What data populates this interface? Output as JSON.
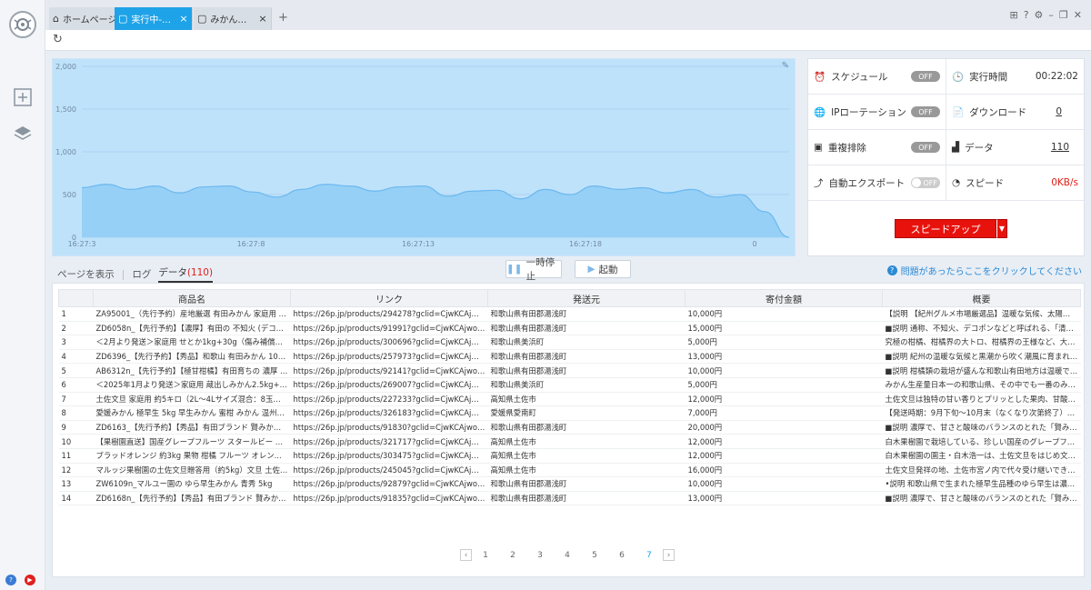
{
  "tabs": [
    {
      "label": "ホームページ"
    },
    {
      "label": "実行中-みかん..."
    },
    {
      "label": "みかん・..."
    }
  ],
  "chart_data": {
    "type": "area",
    "x_ticks": [
      "16:27:3",
      "16:27:8",
      "16:27:13",
      "16:27:18",
      "0"
    ],
    "y_ticks": [
      "2,000",
      "1,500",
      "1,000",
      "500",
      "0"
    ],
    "ylim": [
      0,
      2000
    ],
    "grid": true,
    "series": [
      {
        "values": [
          580,
          620,
          560,
          600,
          520,
          590,
          600,
          530,
          470,
          560,
          620,
          600,
          540,
          590,
          600,
          480,
          540,
          550,
          450,
          560,
          500,
          600,
          560,
          580,
          520,
          560,
          470,
          500,
          300,
          0
        ]
      }
    ],
    "colors": {
      "fill": "#8fcdf5",
      "line": "#6bb8ef"
    }
  },
  "stats": {
    "schedule": {
      "label": "スケジュール",
      "state": "OFF"
    },
    "runtime": {
      "label": "実行時間",
      "value": "00:22:02"
    },
    "ip": {
      "label": "IPローテーション",
      "state": "OFF"
    },
    "download": {
      "label": "ダウンロード",
      "value": "0"
    },
    "dedupe": {
      "label": "重複排除",
      "state": "OFF"
    },
    "data": {
      "label": "データ",
      "value": "110"
    },
    "export": {
      "label": "自動エクスポート",
      "state": "OFF"
    },
    "speed": {
      "label": "スピード",
      "value": "0KB/s"
    },
    "speed_button": "スピードアップ"
  },
  "panel": {
    "tab_page": "ページを表示",
    "tab_log": "ログ",
    "tab_data": "データ",
    "data_count": "(110)",
    "pause": "一時停止",
    "start": "起動",
    "help": "問題があったらここをクリックしてください"
  },
  "table": {
    "columns": [
      "",
      "商品名",
      "リンク",
      "発送元",
      "寄付金額",
      "概要"
    ],
    "rows": [
      [
        "1",
        "ZA95001_（先行予約）産地厳選 有田みかん 家庭用 約5kg(2...",
        "https://26p.jp/products/294278?gclid=CjwKCAjwooq3BhB3Eiw...",
        "和歌山県有田郡湯浅町",
        "10,000円",
        "【説明 【紀州グルメ市場厳選品】温暖な気候、太陽が降..."
      ],
      [
        "2",
        "ZD6058n_【先行予約】【濃厚】有田の 不知火 (デコポン) 約...",
        "https://26p.jp/products/91991?gclid=CjwKCAjwooq3BhB3Eiw...",
        "和歌山県有田郡湯浅町",
        "15,000円",
        "■説明 通称、不知火、デコポンなどと呼ばれる、「清見」と..."
      ],
      [
        "3",
        "＜2月より発送＞家庭用 せとか1kg+30g（傷み補償分）【柑...",
        "https://26p.jp/products/300696?gclid=CjwKCAjwooq3BhB3Eiw...",
        "和歌山県美浜町",
        "5,000円",
        "究極の柑橘、柑橘界の大トロ、柑橘界の王様など、大評判の..."
      ],
      [
        "4",
        "ZD6396_【先行予約】【秀品】和歌山 有田みかん 10kg (2L...",
        "https://26p.jp/products/257973?gclid=CjwKCAjwooq3BhB3Eiw...",
        "和歌山県有田郡湯浅町",
        "13,000円",
        "■説明 紀州の温暖な気候と黒潮から吹く潮風に育まれたみか..."
      ],
      [
        "5",
        "AB6312n_【先行予約】【極甘柑橘】有田育ちの 濃厚 ポンカ...",
        "https://26p.jp/products/92141?gclid=CjwKCAjwooq3BhB3Eiw...",
        "和歌山県有田郡湯浅町",
        "10,000円",
        "■説明 柑橘類の栽培が盛んな和歌山有田地方は温暖で降水量..."
      ],
      [
        "6",
        "＜2025年1月より発送＞家庭用 蔵出しみかん2.5kg+75g（傷...",
        "https://26p.jp/products/269007?gclid=CjwKCAjwooq3BhB3Eiw...",
        "和歌山県美浜町",
        "5,000円",
        "みかん生産量日本一の和歌山県、その中でも一番のみかんど..."
      ],
      [
        "7",
        "土佐文旦 家庭用 約5キロ（2L～4Lサイズ混合：8玉～12玉）...",
        "https://26p.jp/products/227233?gclid=CjwKCAjwooq3BhB3Eiw...",
        "高知県土佐市",
        "12,000円",
        "土佐文旦は独特の甘い香りとプリッとした果肉、甘酸っぱい..."
      ],
      [
        "8",
        "愛媛みかん 極早生 5kg 早生みかん 蜜柑 みかん 温州みかん...",
        "https://26p.jp/products/326183?gclid=CjwKCAjwooq3BhB3Eiw...",
        "愛媛県愛南町",
        "7,000円",
        "【発送時期：9月下旬～10月末（なくなり次第終了）極早生..."
      ],
      [
        "9",
        "ZD6163_【先行予約】【秀品】有田ブランド 賢みかん 10kg...",
        "https://26p.jp/products/91830?gclid=CjwKCAjwooq3BhB3Eiw...",
        "和歌山県有田郡湯浅町",
        "20,000円",
        "■説明 濃厚で、甘さと酸味のバランスのとれた「賢みかん」..."
      ],
      [
        "10",
        "【果樹園直送】国産グレープフルーツ スタールビー 約3k...",
        "https://26p.jp/products/321717?gclid=CjwKCAjwooq3BhB3Eiw...",
        "高知県土佐市",
        "12,000円",
        "白木果樹園で栽培している、珍しい国産のグレープフルーツ..."
      ],
      [
        "11",
        "ブラッドオレンジ 約3kg 果物 柑橘 フルーツ オレン...",
        "https://26p.jp/products/303475?gclid=CjwKCAjwooq3BhB3Eiw...",
        "高知県土佐市",
        "12,000円",
        "白木果樹園の園主・白木浩一は、土佐文旦をはじめ文旦類で..."
      ],
      [
        "12",
        "マルッジ果樹園の土佐文旦贈答用（約5kg）文旦 土佐文旦 ぶ...",
        "https://26p.jp/products/245045?gclid=CjwKCAjwooq3BhB3Eiw...",
        "高知県土佐市",
        "16,000円",
        "土佐文旦発祥の地、土佐市宮ノ内で代々受け継いできた土佐..."
      ],
      [
        "13",
        "ZW6109n_マルユー園の ゆら早生みかん 青秀 5kg",
        "https://26p.jp/products/92879?gclid=CjwKCAjwooq3BhB3Eiw...",
        "和歌山県有田郡湯浅町",
        "10,000円",
        "•説明 和歌山県で生まれた極早生品種のゆら早生は濃厚な甘..."
      ],
      [
        "14",
        "ZD6168n_【先行予約】【秀品】有田ブランド 賢みかん 5kg...",
        "https://26p.jp/products/91835?gclid=CjwKCAjwooq3BhB3Eiw...",
        "和歌山県有田郡湯浅町",
        "13,000円",
        "■説明 濃厚で、甘さと酸味のバランスのとれた「賢みかん」..."
      ]
    ]
  },
  "pagination": {
    "pages": [
      "1",
      "2",
      "3",
      "4",
      "5",
      "6",
      "7"
    ],
    "current": "7"
  },
  "icons": {
    "sidebar": [
      "add-task-icon",
      "layers-icon"
    ],
    "bottom": [
      "help-icon",
      "youtube-icon"
    ]
  }
}
